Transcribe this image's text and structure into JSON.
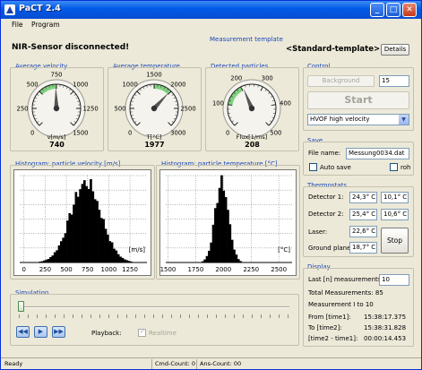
{
  "window": {
    "title": "PaCT 2.4",
    "buttons": {
      "minimize": "_",
      "maximize": "□",
      "close": "✕"
    }
  },
  "menu": {
    "items": [
      "File",
      "Program"
    ]
  },
  "status_message": "NIR-Sensor disconnected!",
  "template": {
    "label": "Measurement template",
    "value": "<Standard-template>",
    "details_button": "Details"
  },
  "gauges": [
    {
      "title": "Average velocity",
      "ticks": [
        "0",
        "250",
        "500",
        "750",
        "1000",
        "1250",
        "1500"
      ],
      "unit": "v[m/s]",
      "value": "740",
      "value_num": 740,
      "min": 0,
      "max": 1500,
      "green_from": 500,
      "green_to": 750
    },
    {
      "title": "Average temperature",
      "ticks": [
        "0",
        "500",
        "1000",
        "1500",
        "2000",
        "2500",
        "3000"
      ],
      "unit": "T[°C]",
      "value": "1977",
      "value_num": 1977,
      "min": 0,
      "max": 3000,
      "green_from": 1500,
      "green_to": 2000
    },
    {
      "title": "Detected particles",
      "ticks": [
        "0",
        "100",
        "200",
        "300",
        "400",
        "500"
      ],
      "unit": "Flux[1/ms]",
      "value": "208",
      "value_num": 208,
      "min": 0,
      "max": 500,
      "green_from": 100,
      "green_to": 200
    }
  ],
  "histograms": [
    {
      "title": "Histogram: particle velocity [m/s]",
      "unit": "[m/s]",
      "ticks": [
        "0",
        "250",
        "500",
        "750",
        "1000",
        "1250"
      ],
      "xmin": -50,
      "xmax": 1450,
      "mean": 730,
      "sd": 180
    },
    {
      "title": "Histogram: particle temperature [°C]",
      "unit": "[°C]",
      "ticks": [
        "1500",
        "1750",
        "2000",
        "2250",
        "2500"
      ],
      "xmin": 1480,
      "xmax": 2620,
      "mean": 1985,
      "sd": 60
    }
  ],
  "control": {
    "label": "Control",
    "background_button": "Background",
    "background_value": "15",
    "start_button": "Start",
    "mode": "HVOF high velocity"
  },
  "save": {
    "label": "Save",
    "file_label": "File name:",
    "file_value": "Messung0034.dat",
    "autosave_label": "Auto save",
    "roh_label": "roh"
  },
  "thermostats": {
    "label": "Thermostats",
    "rows": [
      {
        "name": "Detector 1:",
        "v1": "24,3° C",
        "v2": "10,1° C"
      },
      {
        "name": "Detector 2:",
        "v1": "25,4° C",
        "v2": "10,6° C"
      },
      {
        "name": "Laser:",
        "v1": "22,6° C"
      },
      {
        "name": "Ground plane:",
        "v1": "18,7° C"
      }
    ],
    "stop_button": "Stop"
  },
  "display": {
    "label": "Display",
    "last_label": "Last [n] measurements:",
    "last_value": "10",
    "total": "Total Measurements: 85",
    "range": "Measurement I to 10",
    "times": [
      {
        "label": "From [time1]:",
        "value": "15:38:17.375"
      },
      {
        "label": "To [time2]:",
        "value": "15:38:31.828"
      },
      {
        "label": "[time2 - time1]:",
        "value": "00:00:14.453"
      }
    ]
  },
  "simulation": {
    "label": "Simulation",
    "playback_label": "Playback:",
    "realtime_label": "Realtime",
    "slider_position": 0
  },
  "statusbar": {
    "ready": "Ready",
    "cmd": "Cmd-Count: 0",
    "ans": "Ans-Count: 00"
  },
  "colors": {
    "accent_blue": "#1a47b8",
    "gauge_green": "#7fd27f",
    "titlebar": "#0058e6"
  }
}
